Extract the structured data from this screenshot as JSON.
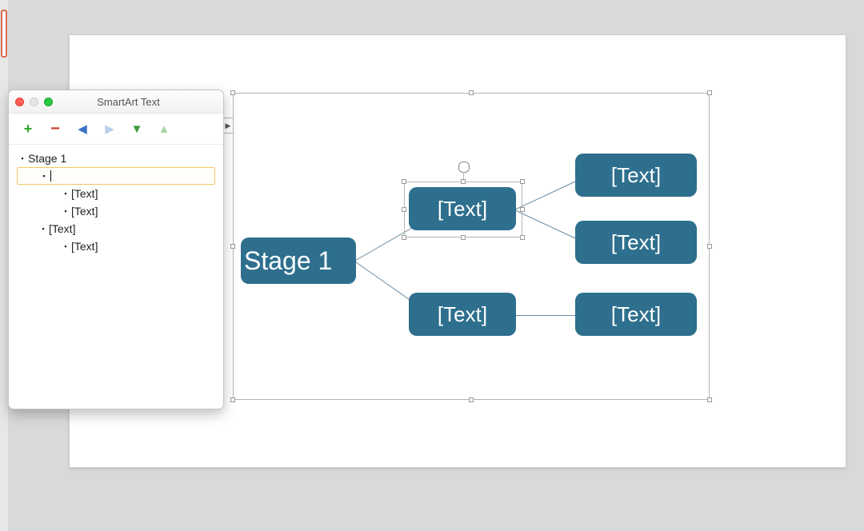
{
  "panel": {
    "title": "SmartArt Text",
    "toolbar": {
      "add": "+",
      "remove": "−",
      "promote_arrow": "◀",
      "demote_arrow": "▶",
      "move_down_arrow": "▼",
      "move_up_arrow": "▲"
    },
    "outline": {
      "items": [
        {
          "level": 0,
          "text": "Stage 1",
          "editing": false
        },
        {
          "level": 1,
          "text": "",
          "editing": true
        },
        {
          "level": 2,
          "text": "[Text]",
          "editing": false
        },
        {
          "level": 2,
          "text": "[Text]",
          "editing": false
        },
        {
          "level": 1,
          "text": "[Text]",
          "editing": false
        },
        {
          "level": 2,
          "text": "[Text]",
          "editing": false
        }
      ]
    }
  },
  "smartart": {
    "toggle_glyph": "▶",
    "nodes": {
      "root": "Stage 1",
      "b1": "[Text]",
      "b1c1": "[Text]",
      "b1c2": "[Text]",
      "b2": "[Text]",
      "b2c1": "[Text]"
    }
  },
  "colors": {
    "node_bg": "#2e6f8e"
  }
}
